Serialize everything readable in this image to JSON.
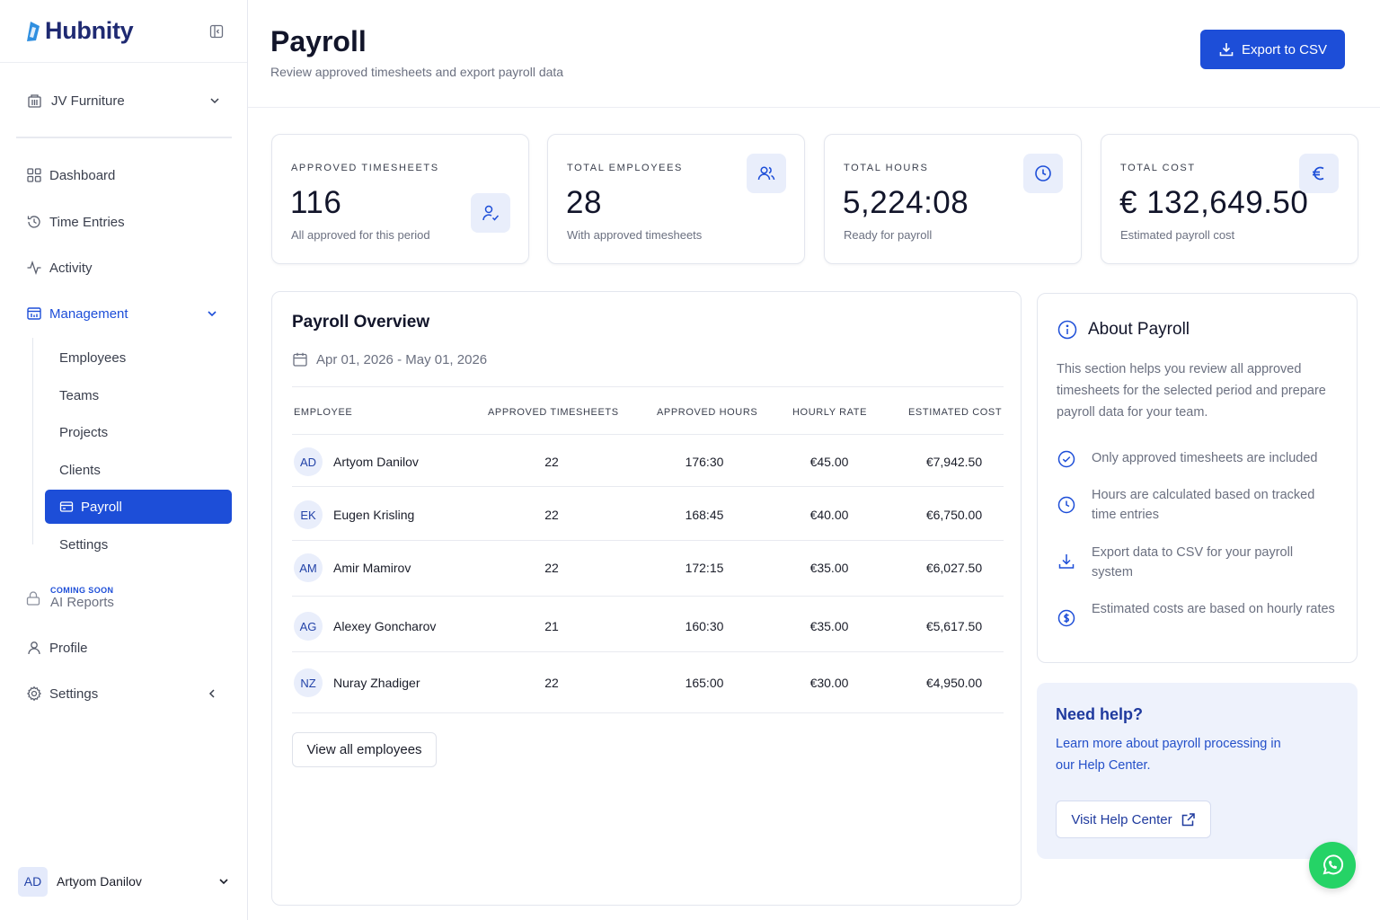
{
  "brand": {
    "name": "Hubnity",
    "accent": "#1d4ed8"
  },
  "sidebar": {
    "org": "JV Furniture",
    "nav": [
      {
        "label": "Dashboard",
        "icon": "grid-icon"
      },
      {
        "label": "Time Entries",
        "icon": "history-icon"
      },
      {
        "label": "Activity",
        "icon": "activity-icon"
      },
      {
        "label": "Management",
        "icon": "calendar-chart-icon"
      }
    ],
    "management_items": [
      {
        "label": "Employees"
      },
      {
        "label": "Teams"
      },
      {
        "label": "Projects"
      },
      {
        "label": "Clients"
      },
      {
        "label": "Payroll",
        "active": true
      },
      {
        "label": "Settings"
      }
    ],
    "ai_reports": {
      "tag": "COMING SOON",
      "label": "AI Reports"
    },
    "profile": "Profile",
    "settings": "Settings",
    "user": {
      "initials": "AD",
      "name": "Artyom Danilov"
    }
  },
  "header": {
    "title": "Payroll",
    "subtitle": "Review approved timesheets and export payroll data",
    "export_label": "Export to CSV"
  },
  "stats": [
    {
      "label": "APPROVED TIMESHEETS",
      "value": "116",
      "note": "All approved for this period",
      "icon": "user-check-icon"
    },
    {
      "label": "TOTAL EMPLOYEES",
      "value": "28",
      "note": "With approved timesheets",
      "icon": "users-icon"
    },
    {
      "label": "TOTAL HOURS",
      "value": "5,224:08",
      "note": "Ready for payroll",
      "icon": "clock-icon"
    },
    {
      "label": "TOTAL COST",
      "value": "€ 132,649.50",
      "note": "Estimated payroll cost",
      "icon": "euro-icon"
    }
  ],
  "overview": {
    "title": "Payroll Overview",
    "date_range": "Apr 01, 2026 - May 01, 2026",
    "columns": [
      "EMPLOYEE",
      "APPROVED TIMESHEETS",
      "APPROVED HOURS",
      "HOURLY RATE",
      "ESTIMATED COST"
    ],
    "rows": [
      {
        "initials": "AD",
        "name": "Artyom Danilov",
        "timesheets": "22",
        "hours": "176:30",
        "rate": "€45.00",
        "cost": "€7,942.50"
      },
      {
        "initials": "EK",
        "name": "Eugen Krisling",
        "timesheets": "22",
        "hours": "168:45",
        "rate": "€40.00",
        "cost": "€6,750.00"
      },
      {
        "initials": "AM",
        "name": "Amir Mamirov",
        "timesheets": "22",
        "hours": "172:15",
        "rate": "€35.00",
        "cost": "€6,027.50"
      },
      {
        "initials": "AG",
        "name": "Alexey Goncharov",
        "timesheets": "21",
        "hours": "160:30",
        "rate": "€35.00",
        "cost": "€5,617.50"
      },
      {
        "initials": "NZ",
        "name": "Nuray Zhadiger",
        "timesheets": "22",
        "hours": "165:00",
        "rate": "€30.00",
        "cost": "€4,950.00"
      }
    ],
    "view_all_label": "View all employees"
  },
  "about": {
    "title": "About Payroll",
    "description": "This section helps you review all approved timesheets for the selected period and prepare payroll data for your team.",
    "items": [
      {
        "icon": "check-circle-icon",
        "text": "Only approved timesheets are included"
      },
      {
        "icon": "clock-icon",
        "text": "Hours are calculated based on tracked time entries"
      },
      {
        "icon": "download-icon",
        "text": "Export data to CSV for your payroll system"
      },
      {
        "icon": "dollar-circle-icon",
        "text": "Estimated costs are based on hourly rates"
      }
    ]
  },
  "help": {
    "title": "Need help?",
    "description": "Learn more about payroll processing in our Help Center.",
    "button_label": "Visit Help Center"
  }
}
